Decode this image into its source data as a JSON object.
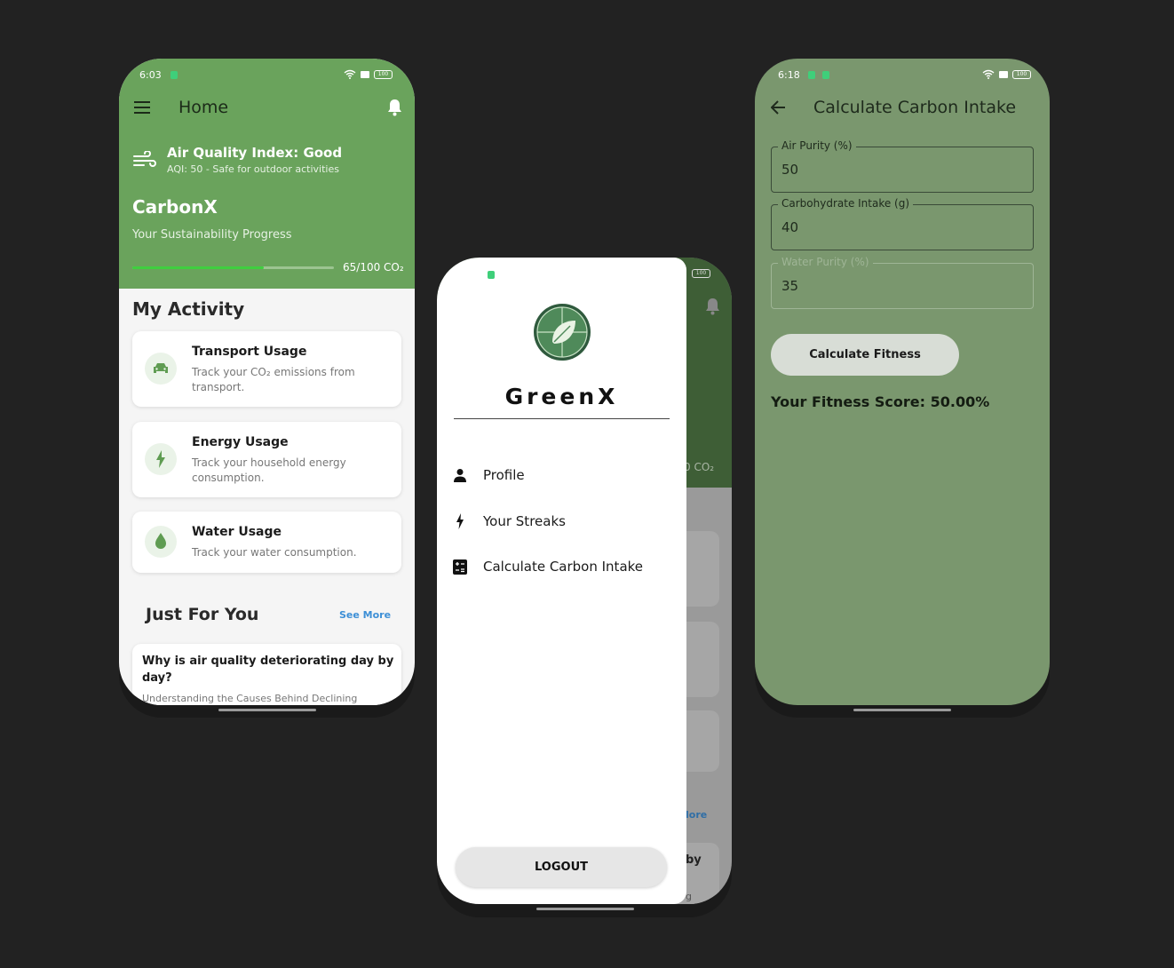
{
  "colors": {
    "background": "#222222",
    "primary_green": "#6aa35c",
    "dark_green": "#3e5e36",
    "form_green": "#7a976e",
    "accent_blue": "#3d8fd6"
  },
  "home": {
    "status": {
      "time": "6:03",
      "battery": "100"
    },
    "title": "Home",
    "air_quality": {
      "title": "Air Quality Index: Good",
      "subtitle": "AQI: 50 - Safe for outdoor activities"
    },
    "brand": "CarbonX",
    "progress_label": "Your Sustainability Progress",
    "progress": {
      "value": 65,
      "max": 100,
      "text": "65/100 CO₂"
    },
    "activity_heading": "My Activity",
    "activities": [
      {
        "icon": "car-icon",
        "title": "Transport Usage",
        "desc_line1": "Track your CO₂ emissions from",
        "desc_line2": "transport."
      },
      {
        "icon": "bolt-icon",
        "title": "Energy Usage",
        "desc_line1": "Track your household energy",
        "desc_line2": "consumption."
      },
      {
        "icon": "water-drop-icon",
        "title": "Water Usage",
        "desc_line1": "Track your water consumption.",
        "desc_line2": ""
      }
    ],
    "just_for_you": "Just For You",
    "see_more": "See More",
    "article": {
      "title_line1": "Why is air quality deteriorating day by",
      "title_line2": "day?",
      "subtitle": "Understanding the Causes Behind Declining"
    }
  },
  "drawer": {
    "status": {
      "battery": "100"
    },
    "app_name": "GreenX",
    "menu": [
      {
        "icon": "person-icon",
        "label": "Profile"
      },
      {
        "icon": "bolt-icon",
        "label": "Your Streaks"
      },
      {
        "icon": "calculator-icon",
        "label": "Calculate Carbon Intake"
      }
    ],
    "logout": "LOGOUT",
    "behind": {
      "co2_fragment": "0 CO₂",
      "more_fragment": "lore",
      "by_fragment": "by",
      "g_fragment": "g"
    }
  },
  "calc": {
    "status": {
      "time": "6:18",
      "battery": "100"
    },
    "title": "Calculate Carbon Intake",
    "fields": [
      {
        "label": "Air Purity (%)",
        "value": "50"
      },
      {
        "label": "Carbohydrate Intake (g)",
        "value": "40"
      },
      {
        "label": "Water Purity (%)",
        "value": "35"
      }
    ],
    "button": "Calculate Fitness",
    "result": "Your Fitness Score: 50.00%"
  }
}
